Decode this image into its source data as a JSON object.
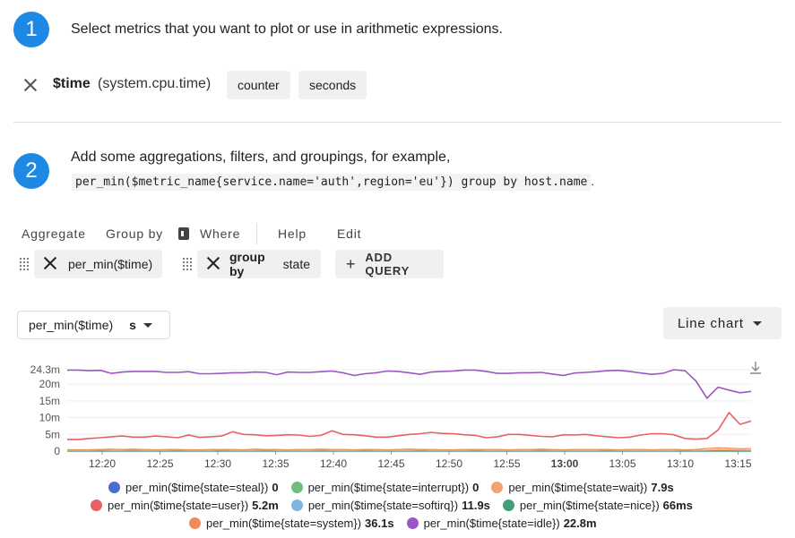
{
  "step1": {
    "number": "1",
    "text": "Select metrics that you want to plot or use in arithmetic expressions."
  },
  "metric": {
    "alias": "$time",
    "name": "(system.cpu.time)",
    "chips": [
      "counter",
      "seconds"
    ]
  },
  "step2": {
    "number": "2",
    "text": "Add some aggregations, filters, and groupings, for example,",
    "code": "per_min($metric_name{service.name='auth',region='eu'}) group by host.name",
    "code_suffix": "."
  },
  "tabs": {
    "aggregate": "Aggregate",
    "group_by": "Group by",
    "where": "Where",
    "help": "Help",
    "edit": "Edit"
  },
  "queries": {
    "q1": "per_min($time)",
    "q2_bold": "group by",
    "q2_rest": " state",
    "add_query": "ADD QUERY"
  },
  "controls": {
    "select_value": "per_min($time)",
    "unit": "s",
    "chart_type": "Line chart"
  },
  "colors": {
    "steal": "#4a6ed0",
    "interrupt": "#6fbf7a",
    "wait": "#f2a172",
    "user": "#e86161",
    "softirq": "#7fb5e2",
    "nice": "#3fa07a",
    "system": "#f08a56",
    "idle": "#9c56c4"
  },
  "chart_data": {
    "type": "line",
    "x": [
      "12:20",
      "12:25",
      "12:30",
      "12:35",
      "12:40",
      "12:45",
      "12:50",
      "12:55",
      "13:00",
      "13:05",
      "13:10",
      "13:15"
    ],
    "x_bold": "13:00",
    "y_ticks": [
      "24.3m",
      "20m",
      "15m",
      "10m",
      "5m",
      "0"
    ],
    "y_tick_values": [
      24.3,
      20,
      15,
      10,
      5,
      0
    ],
    "ylim": [
      0,
      24.3
    ],
    "series": [
      {
        "name": "per_min($time{state=idle})",
        "key": "idle",
        "values": [
          24.2,
          24.2,
          24.0,
          24.1,
          23.2,
          23.6,
          23.8,
          23.8,
          23.8,
          23.5,
          23.5,
          23.7,
          23.1,
          23.1,
          23.2,
          23.4,
          23.4,
          23.6,
          23.5,
          22.8,
          23.6,
          23.5,
          23.5,
          23.7,
          23.9,
          23.4,
          22.6,
          23.1,
          23.4,
          23.9,
          23.8,
          23.4,
          22.9,
          23.6,
          23.8,
          23.9,
          24.2,
          24.2,
          23.8,
          23.2,
          23.2,
          23.4,
          23.4,
          23.5,
          23.0,
          22.6,
          23.3,
          23.5,
          23.7,
          24.0,
          24.1,
          23.8,
          23.3,
          22.9,
          23.2,
          24.3,
          24.0,
          20.9,
          15.8,
          19.1,
          18.2,
          17.4,
          17.8
        ]
      },
      {
        "name": "per_min($time{state=user})",
        "key": "user",
        "values": [
          3.5,
          3.5,
          3.8,
          4.0,
          4.3,
          4.5,
          4.2,
          4.2,
          4.5,
          4.3,
          4.0,
          4.8,
          4.1,
          4.3,
          4.5,
          5.8,
          5.0,
          4.9,
          4.6,
          4.7,
          4.9,
          4.8,
          4.4,
          4.7,
          6.1,
          5.0,
          4.9,
          4.6,
          4.2,
          4.2,
          4.6,
          5.0,
          5.2,
          5.6,
          5.3,
          5.2,
          4.9,
          4.7,
          4.0,
          4.3,
          5.0,
          5.0,
          4.7,
          4.4,
          4.3,
          4.9,
          4.8,
          5.0,
          4.6,
          4.3,
          4.0,
          4.2,
          4.8,
          5.2,
          5.2,
          4.9,
          3.8,
          3.6,
          3.8,
          6.3,
          11.5,
          8.0,
          9.0
        ]
      },
      {
        "name": "per_min($time{state=system})",
        "key": "system",
        "values": [
          0.4,
          0.4,
          0.4,
          0.5,
          0.6,
          0.5,
          0.6,
          0.5,
          0.4,
          0.5,
          0.5,
          0.4,
          0.4,
          0.5,
          0.5,
          0.5,
          0.4,
          0.6,
          0.5,
          0.5,
          0.4,
          0.5,
          0.5,
          0.6,
          0.5,
          0.5,
          0.4,
          0.5,
          0.5,
          0.4,
          0.5,
          0.6,
          0.5,
          0.5,
          0.4,
          0.4,
          0.5,
          0.5,
          0.5,
          0.5,
          0.4,
          0.5,
          0.5,
          0.6,
          0.5,
          0.4,
          0.5,
          0.5,
          0.5,
          0.5,
          0.4,
          0.5,
          0.5,
          0.4,
          0.5,
          0.5,
          0.4,
          0.5,
          0.8,
          1.0,
          0.9,
          0.7,
          0.8
        ]
      },
      {
        "name": "per_min($time{state=wait})",
        "key": "wait",
        "values": [
          0.2,
          0.2,
          0.2,
          0.3,
          0.2,
          0.2,
          0.3,
          0.2,
          0.2,
          0.2,
          0.3,
          0.2,
          0.2,
          0.2,
          0.3,
          0.2,
          0.2,
          0.2,
          0.3,
          0.2,
          0.2,
          0.2,
          0.2,
          0.3,
          0.2,
          0.2,
          0.2,
          0.3,
          0.2,
          0.2,
          0.2,
          0.2,
          0.3,
          0.2,
          0.2,
          0.2,
          0.2,
          0.3,
          0.2,
          0.2,
          0.2,
          0.2,
          0.2,
          0.3,
          0.2,
          0.2,
          0.2,
          0.2,
          0.2,
          0.3,
          0.2,
          0.2,
          0.2,
          0.2,
          0.2,
          0.2,
          0.3,
          0.2,
          0.3,
          0.4,
          0.4,
          0.3,
          0.3
        ]
      },
      {
        "name": "per_min($time{state=steal})",
        "key": "steal",
        "values": [
          0,
          0
        ]
      },
      {
        "name": "per_min($time{state=interrupt})",
        "key": "interrupt",
        "values": [
          0,
          0
        ]
      },
      {
        "name": "per_min($time{state=softirq})",
        "key": "softirq",
        "values": [
          0.05,
          0.05
        ]
      },
      {
        "name": "per_min($time{state=nice})",
        "key": "nice",
        "values": [
          0.02,
          0.02
        ]
      }
    ]
  },
  "legend": {
    "row1": [
      {
        "key": "steal",
        "label": "per_min($time{state=steal})",
        "value": "0"
      },
      {
        "key": "interrupt",
        "label": "per_min($time{state=interrupt})",
        "value": "0"
      },
      {
        "key": "wait",
        "label": "per_min($time{state=wait})",
        "value": "7.9s"
      }
    ],
    "row2": [
      {
        "key": "user",
        "label": "per_min($time{state=user})",
        "value": "5.2m"
      },
      {
        "key": "softirq",
        "label": "per_min($time{state=softirq})",
        "value": "11.9s"
      },
      {
        "key": "nice",
        "label": "per_min($time{state=nice})",
        "value": "66ms"
      }
    ],
    "row3": [
      {
        "key": "system",
        "label": "per_min($time{state=system})",
        "value": "36.1s"
      },
      {
        "key": "idle",
        "label": "per_min($time{state=idle})",
        "value": "22.8m"
      }
    ]
  }
}
